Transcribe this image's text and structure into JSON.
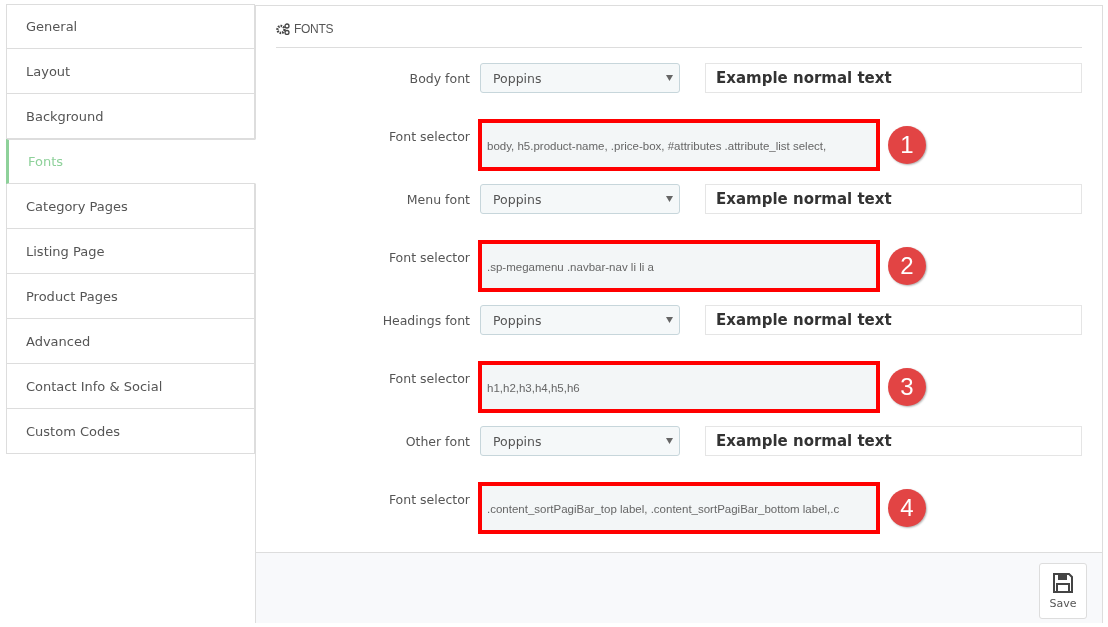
{
  "sidebar": {
    "items": [
      {
        "label": "General",
        "selected": false
      },
      {
        "label": "Layout",
        "selected": false
      },
      {
        "label": "Background",
        "selected": false
      },
      {
        "label": "Fonts",
        "selected": true
      },
      {
        "label": "Category Pages",
        "selected": false
      },
      {
        "label": "Listing Page",
        "selected": false
      },
      {
        "label": "Product Pages",
        "selected": false
      },
      {
        "label": "Advanced",
        "selected": false
      },
      {
        "label": "Contact Info & Social",
        "selected": false
      },
      {
        "label": "Custom Codes",
        "selected": false
      }
    ]
  },
  "panel": {
    "title": "FONTS",
    "groups": [
      {
        "font_label": "Body font",
        "font_value": "Poppins",
        "example": "Example normal text",
        "selector_label": "Font selector",
        "selector_value": "body, h5.product-name, .price-box, #attributes .attribute_list select,",
        "badge": "1"
      },
      {
        "font_label": "Menu font",
        "font_value": "Poppins",
        "example": "Example normal text",
        "selector_label": "Font selector",
        "selector_value": ".sp-megamenu .navbar-nav  li li a",
        "badge": "2"
      },
      {
        "font_label": "Headings font",
        "font_value": "Poppins",
        "example": "Example normal text",
        "selector_label": "Font selector",
        "selector_value": "h1,h2,h3,h4,h5,h6",
        "badge": "3"
      },
      {
        "font_label": "Other font",
        "font_value": "Poppins",
        "example": "Example normal text",
        "selector_label": "Font selector",
        "selector_value": ".content_sortPagiBar_top label, .content_sortPagiBar_bottom label,.c",
        "badge": "4"
      }
    ],
    "save_label": "Save"
  }
}
